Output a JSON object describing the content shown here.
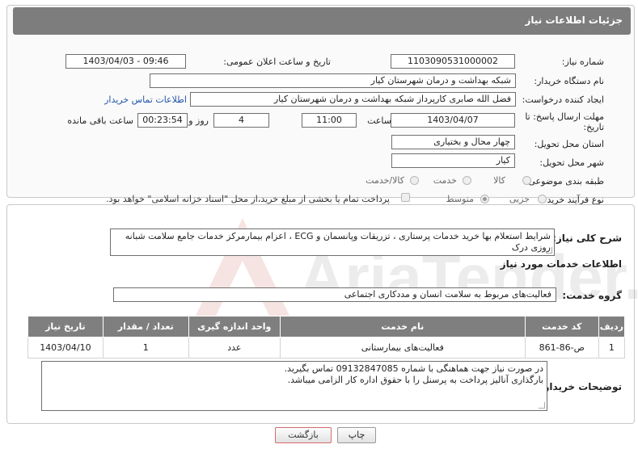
{
  "header": {
    "title": "جزئیات اطلاعات نیاز"
  },
  "fields": {
    "need_number_label": "شماره نیاز:",
    "need_number": "1103090531000002",
    "announce_label": "تاریخ و ساعت اعلان عمومی:",
    "announce_value": "1403/04/03 - 09:46",
    "buyer_org_label": "نام دستگاه خریدار:",
    "buyer_org": "شبکه بهداشت و درمان شهرستان کیار",
    "requester_label": "ایجاد کننده درخواست:",
    "requester": "فضل الله صابری کارپرداز شبکه بهداشت و درمان شهرستان کیار",
    "contact_link": "اطلاعات تماس خریدار",
    "deadline_label_1": "مهلت ارسال پاسخ: تا",
    "deadline_label_2": "تاریخ:",
    "deadline_date": "1403/04/07",
    "time_label": "ساعت",
    "deadline_time": "11:00",
    "days_value": "4",
    "days_label": "روز و",
    "remaining_time": "00:23:54",
    "remaining_label": "ساعت باقی مانده",
    "province_label": "استان محل تحویل:",
    "province": "چهار محال و بختیاری",
    "city_label": "شهر محل تحویل:",
    "city": "کیار",
    "category_label": "طبقه بندی موضوعی:",
    "category_options": [
      "کالا",
      "خدمت",
      "کالا/خدمت"
    ],
    "process_label": "نوع فرآیند خرید :",
    "process_options": [
      "جزیی",
      "متوسط"
    ],
    "payment_note": "پرداخت تمام یا بخشی از مبلغ خرید،از محل \"اسناد خزانه اسلامی\" خواهد بود."
  },
  "description": {
    "label": "شرح کلی نیاز:",
    "text": "شرایط استعلام بها خرید  خدمات  پرستاری ، تزریقات وپانسمان و ECG ، اعزام بیمارمرکز خدمات جامع سلامت شبانه روزی  درک"
  },
  "services_title": "اطلاعات خدمات مورد نیاز",
  "service_group": {
    "label": "گروه خدمت:",
    "value": "فعالیت‌های مربوط به سلامت انسان و مددکاری اجتماعی"
  },
  "table": {
    "headers": [
      "ردیف",
      "کد خدمت",
      "نام خدمت",
      "واحد اندازه گیری",
      "تعداد / مقدار",
      "تاریخ نیاز"
    ],
    "rows": [
      [
        "1",
        "ص-86-861",
        "فعالیت‌های بیمارستانی",
        "عدد",
        "1",
        "1403/04/10"
      ]
    ]
  },
  "buyer_notes": {
    "label": "توضیحات خریدار:",
    "line1": "در صورت نیاز جهت هماهنگی با شماره 09132847085 تماس بگیرید.",
    "line2": "بارگذاری آنالیز پرداخت به پرسنل را با حقوق اداره کار الزامی میباشد."
  },
  "buttons": {
    "print": "چاپ",
    "back": "بازگشت"
  },
  "watermark": {
    "text": "AriaTender.neT"
  }
}
